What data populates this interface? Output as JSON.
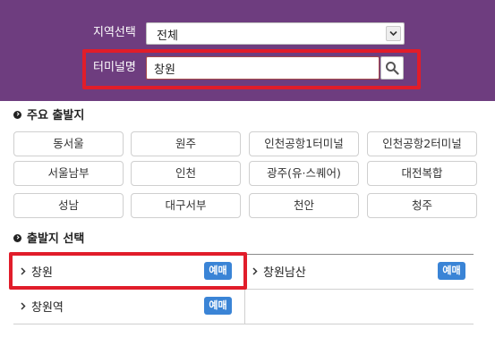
{
  "search": {
    "region_label": "지역선택",
    "region_value": "전체",
    "terminal_label": "터미널명",
    "terminal_value": "창원"
  },
  "major_departures": {
    "title": "주요 출발지",
    "items": [
      "동서울",
      "원주",
      "인천공항1터미널",
      "인천공항2터미널",
      "서울남부",
      "인천",
      "광주(유·스퀘어)",
      "대전복합",
      "성남",
      "대구서부",
      "천안",
      "청주"
    ]
  },
  "departure_select": {
    "title": "출발지 선택",
    "results": [
      {
        "name": "창원",
        "book_label": "예매"
      },
      {
        "name": "창원남산",
        "book_label": "예매"
      },
      {
        "name": "창원역",
        "book_label": "예매"
      }
    ]
  },
  "colors": {
    "header_bg": "#6e3d7f",
    "highlight": "#e11d2a",
    "book_button": "#3a84d6"
  }
}
